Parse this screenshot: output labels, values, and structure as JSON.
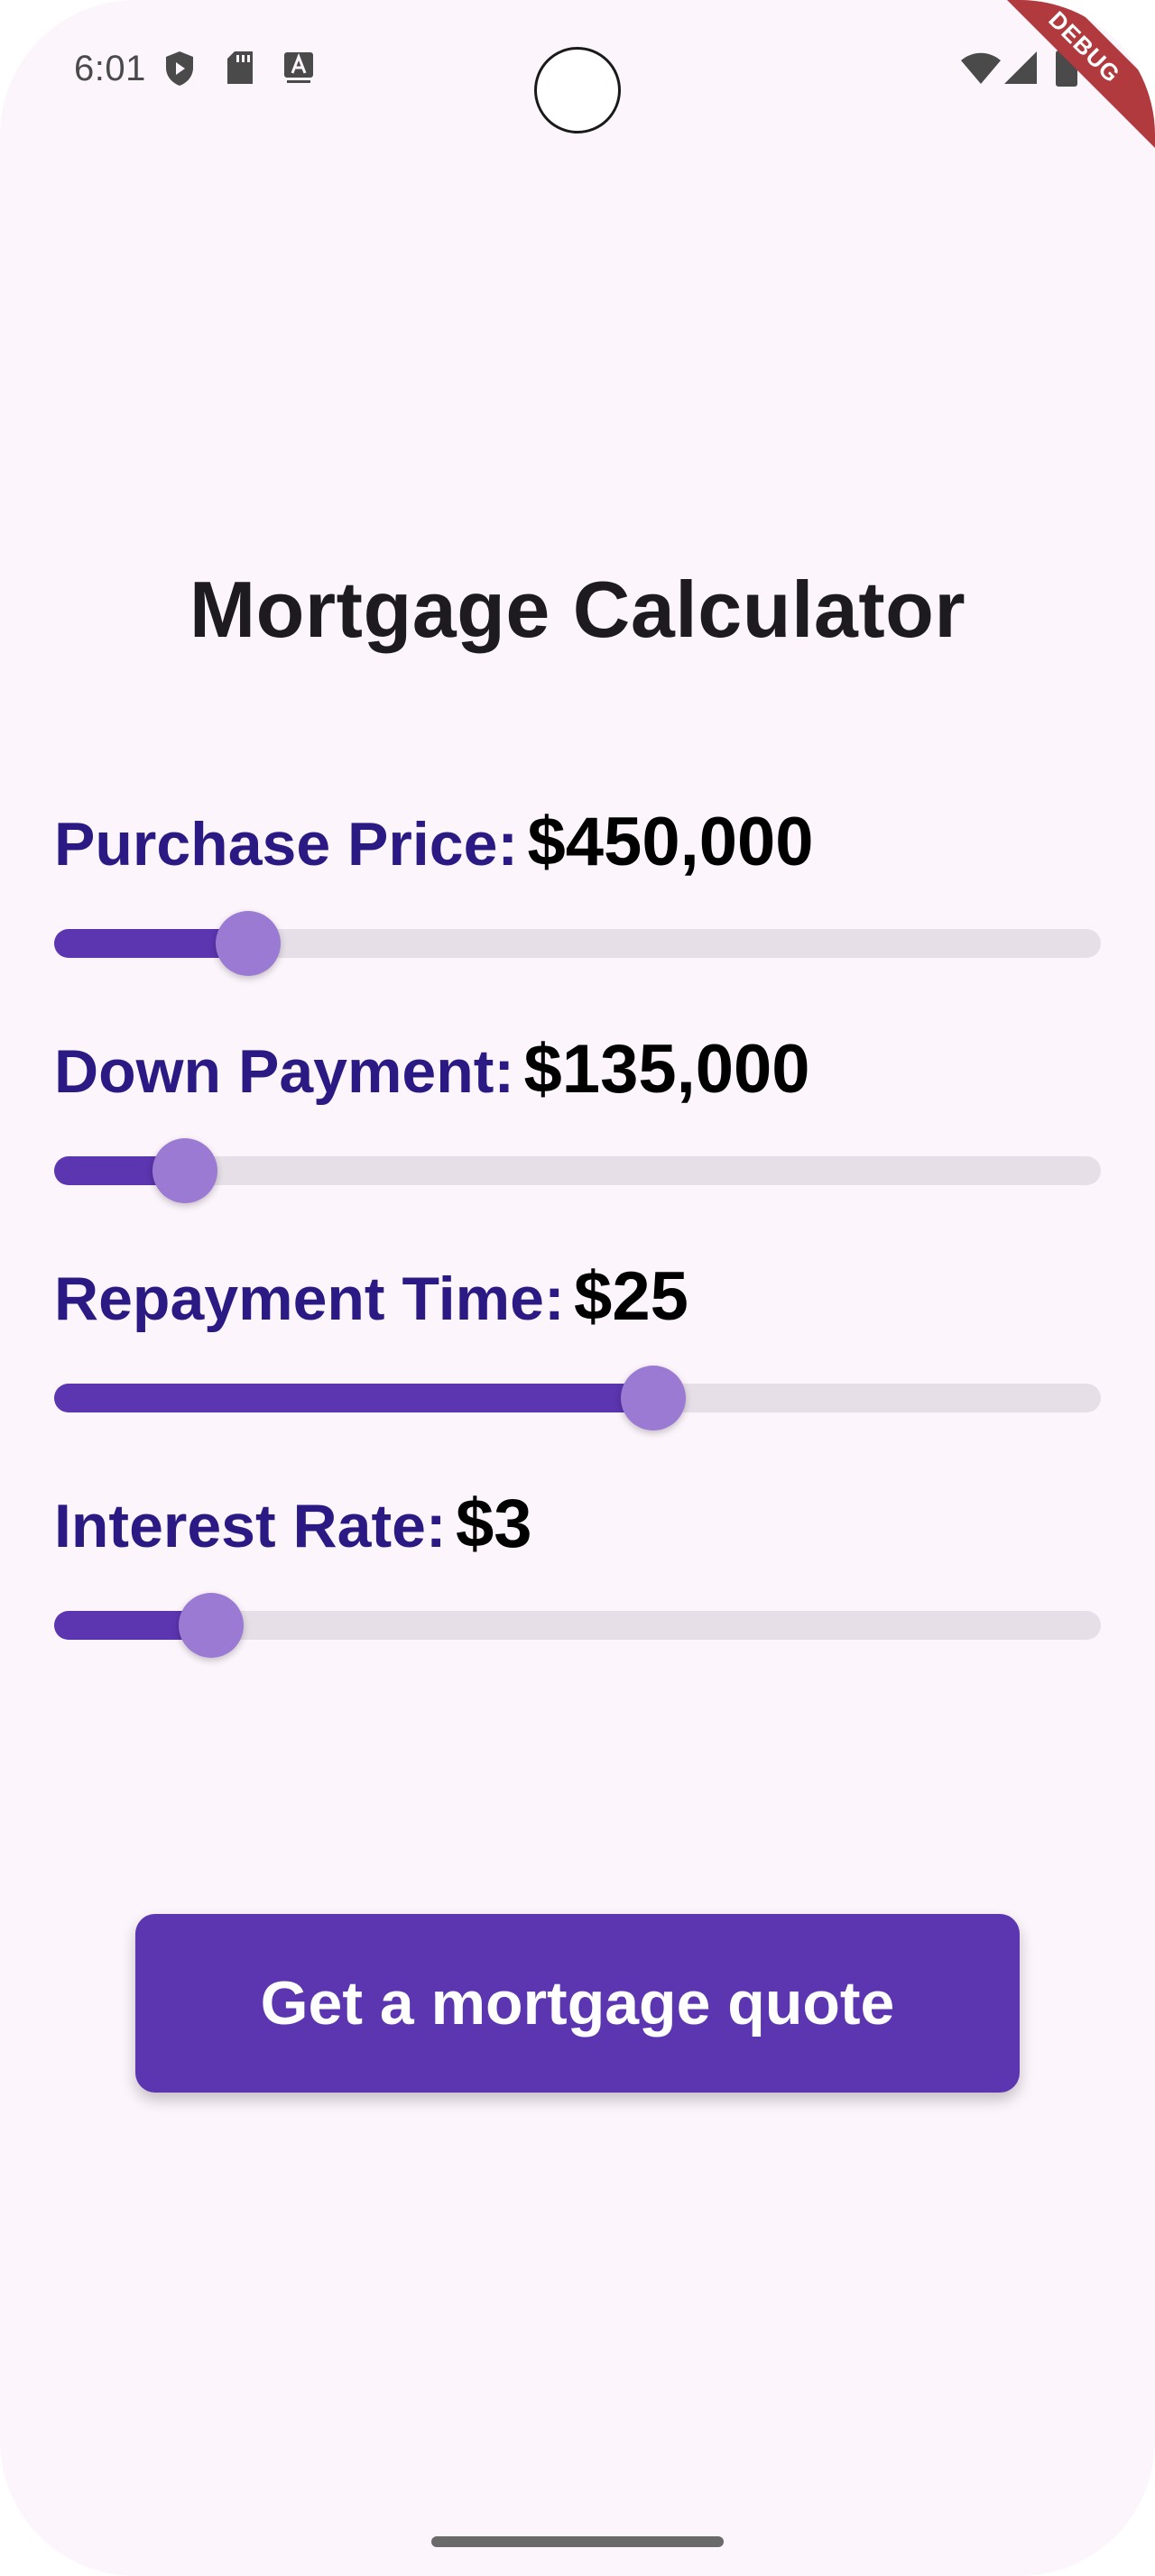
{
  "status_bar": {
    "time": "6:01",
    "left_icons": [
      "shield-play-icon",
      "sd-card-icon",
      "font-a-icon"
    ],
    "right_icons": [
      "wifi-icon",
      "cell-signal-icon",
      "battery-icon"
    ],
    "debug_banner": "DEBUG"
  },
  "page": {
    "title": "Mortgage Calculator"
  },
  "sliders": [
    {
      "name": "Purchase Price:",
      "value": "$450,000",
      "level": 0.185
    },
    {
      "name": "Down Payment:",
      "value": "$135,000",
      "level": 0.125
    },
    {
      "name": "Repayment Time:",
      "value": "$25",
      "level": 0.572
    },
    {
      "name": "Interest Rate:",
      "value": "$3",
      "level": 0.15
    }
  ],
  "actions": {
    "quote_label": "Get a mortgage quote"
  },
  "colors": {
    "accent": "#5c35b0",
    "thumb": "#9b7ad4",
    "label": "#2b1a83",
    "background": "#fcf5fc",
    "track_inactive": "#e6dfe7",
    "debug_ribbon": "#b03a3e"
  }
}
